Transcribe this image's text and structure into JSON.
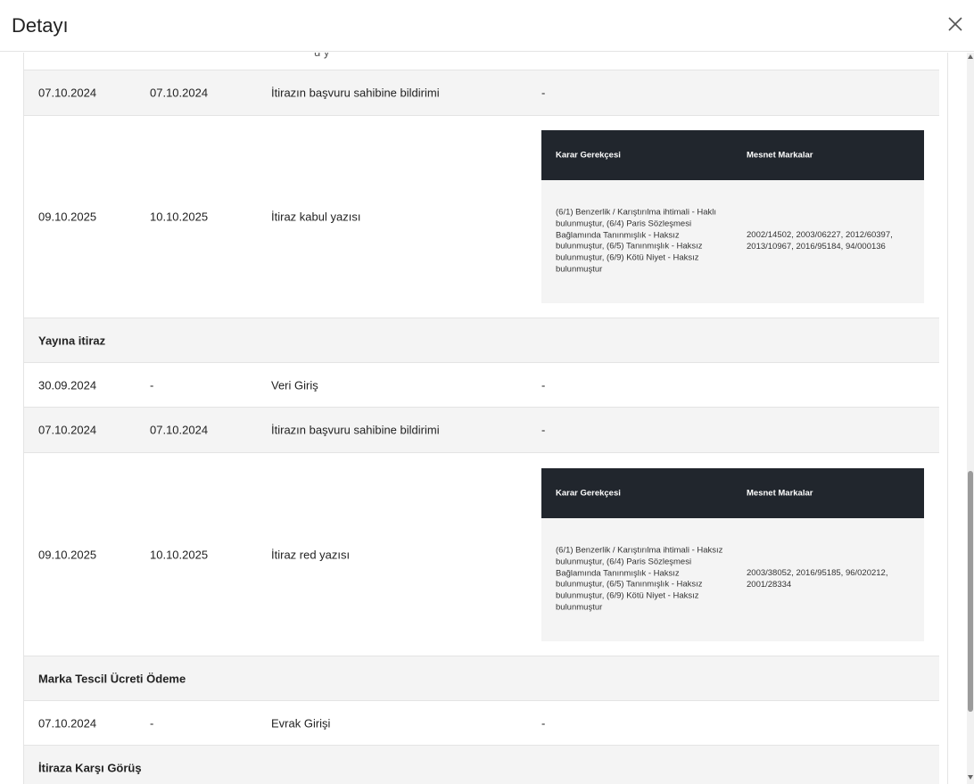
{
  "header": {
    "title": "Detayı"
  },
  "top_partial": "ü y",
  "rows": {
    "r1": {
      "date1": "07.10.2024",
      "date2": "07.10.2024",
      "action": "İtirazın başvuru sahibine bildirimi",
      "detail": "-"
    },
    "r2": {
      "date1": "09.10.2025",
      "date2": "10.10.2025",
      "action": "İtiraz kabul yazısı",
      "table": {
        "h1": "Karar Gerekçesi",
        "h2": "Mesnet Markalar",
        "reason": "(6/1) Benzerlik / Karıştırılma ihtimali - Haklı bulunmuştur, (6/4) Paris Sözleşmesi Bağlamında Tanınmışlık - Haksız bulunmuştur, (6/5) Tanınmışlık - Haksız bulunmuştur, (6/9) Kötü Niyet - Haksız bulunmuştur",
        "marks": "2002/14502, 2003/06227, 2012/60397, 2013/10967, 2016/95184, 94/000136"
      }
    },
    "s1": {
      "title": "Yayına itiraz"
    },
    "r3": {
      "date1": "30.09.2024",
      "date2": "-",
      "action": "Veri Giriş",
      "detail": "-"
    },
    "r4": {
      "date1": "07.10.2024",
      "date2": "07.10.2024",
      "action": "İtirazın başvuru sahibine bildirimi",
      "detail": "-"
    },
    "r5": {
      "date1": "09.10.2025",
      "date2": "10.10.2025",
      "action": "İtiraz red yazısı",
      "table": {
        "h1": "Karar Gerekçesi",
        "h2": "Mesnet Markalar",
        "reason": "(6/1) Benzerlik / Karıştırılma ihtimali - Haksız bulunmuştur, (6/4) Paris Sözleşmesi Bağlamında Tanınmışlık - Haksız bulunmuştur, (6/5) Tanınmışlık - Haksız bulunmuştur, (6/9) Kötü Niyet - Haksız bulunmuştur",
        "marks": "2003/38052, 2016/95185, 96/020212, 2001/28334"
      }
    },
    "s2": {
      "title": "Marka Tescil Ücreti Ödeme"
    },
    "r6": {
      "date1": "07.10.2024",
      "date2": "-",
      "action": "Evrak Girişi",
      "detail": "-"
    },
    "s3": {
      "title": "İtiraza Karşı Görüş"
    }
  },
  "icons": {
    "close": "close-icon"
  },
  "colors": {
    "table_header_bg": "#21262d",
    "row_gray": "#f4f4f4"
  }
}
